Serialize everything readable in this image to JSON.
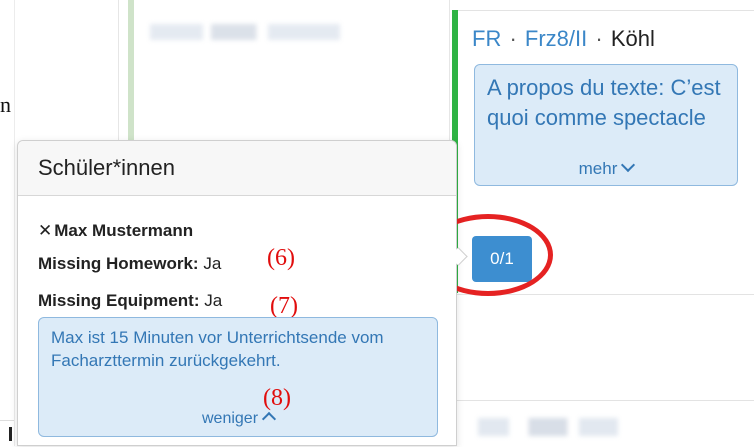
{
  "background_fragments": {
    "edge_letter": "n"
  },
  "lesson": {
    "subject": "FR",
    "group": "Frz8/II",
    "teacher": "Köhl",
    "separator": "·",
    "note_text": "A propos du texte: C’est quoi comme spectacle",
    "more_label": "mehr",
    "count_label": "0/1"
  },
  "popover": {
    "title": "Schüler*innen",
    "student_name": "Max Mustermann",
    "remove_symbol": "✕",
    "fields": [
      {
        "label": "Missing Homework:",
        "value": "Ja",
        "annotation": "(6)"
      },
      {
        "label": "Missing Equipment:",
        "value": "Ja",
        "annotation": "(7)"
      }
    ],
    "remark_text": "Max ist 15 Minuten vor Unterrichtsende vom Facharzttermin zurückgekehrt.",
    "remark_annotation": "(8)",
    "less_label": "weniger"
  },
  "colors": {
    "accent_green": "#2fb344",
    "link_blue": "#3b87c8",
    "note_bg": "#dcebf8",
    "button_blue": "#3d8ed0",
    "annotation_red": "#e10d0d"
  }
}
